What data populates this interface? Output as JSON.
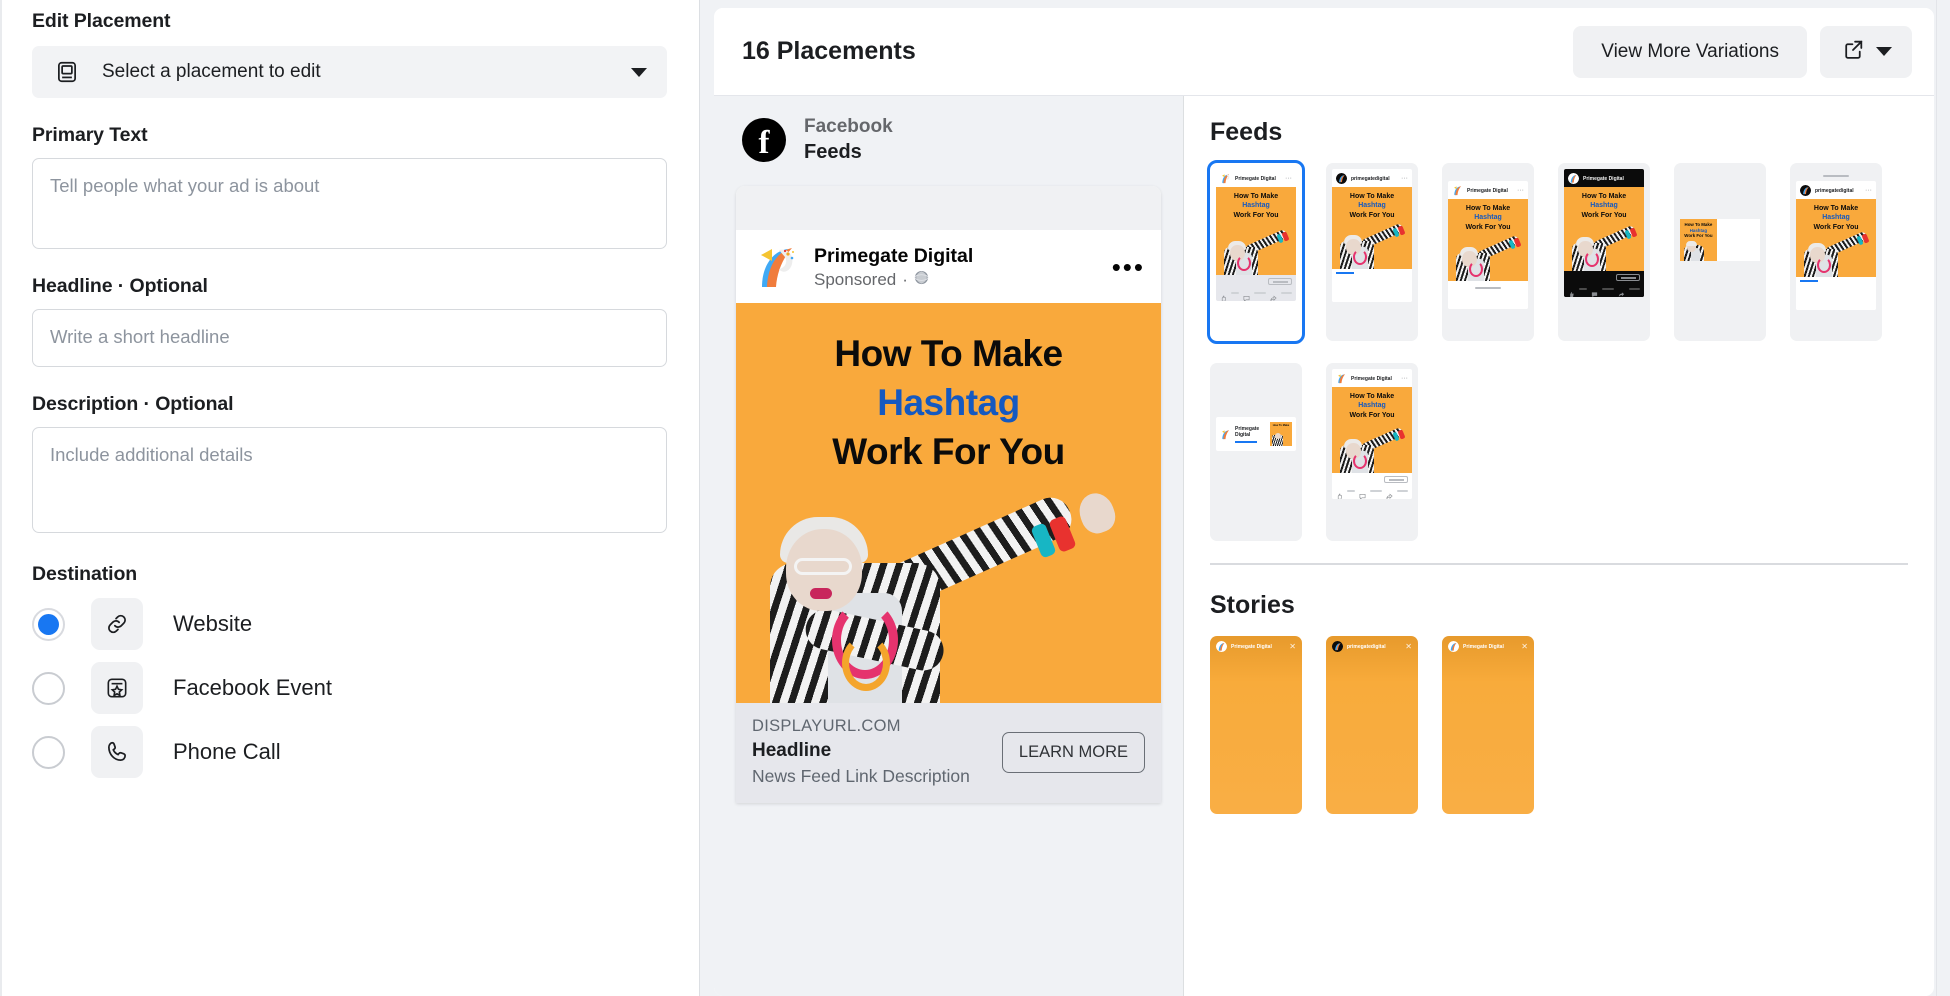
{
  "left_panel": {
    "edit_placement_label": "Edit Placement",
    "placement_select": {
      "text": "Select a placement to edit",
      "icon": "monitor-icon",
      "caret": "chevron-down-icon"
    },
    "primary_text": {
      "label": "Primary Text",
      "placeholder": "Tell people what your ad is about",
      "value": ""
    },
    "headline": {
      "label": "Headline",
      "optional_suffix": " · Optional",
      "placeholder": "Write a short headline",
      "value": ""
    },
    "description": {
      "label": "Description",
      "optional_suffix": " · Optional",
      "placeholder": "Include additional details",
      "value": ""
    },
    "destination": {
      "label": "Destination",
      "selected": "Website",
      "options": [
        {
          "label": "Website",
          "icon": "link-icon",
          "checked": true
        },
        {
          "label": "Facebook Event",
          "icon": "event-star-icon",
          "checked": false
        },
        {
          "label": "Phone Call",
          "icon": "phone-icon",
          "checked": false
        }
      ]
    }
  },
  "preview": {
    "header": {
      "title": "16 Placements",
      "view_more_label": "View More Variations",
      "open_icon": "external-link-icon",
      "caret_icon": "chevron-down-icon"
    },
    "platform": {
      "logo_icon": "facebook-icon",
      "name": "Facebook",
      "surface": "Feeds"
    },
    "ad": {
      "page_name": "Primegate Digital",
      "sponsored_label": "Sponsored",
      "sponsored_separator": "·",
      "globe_icon": "globe-icon",
      "menu_icon": "more-options-icon",
      "creative": {
        "line1": "How To Make",
        "line2": "Hashtag",
        "line3": "Work For You",
        "bg_color": "#F9A93C",
        "accent_color": "#1559C0"
      },
      "footer": {
        "display_url": "DISPLAYURL.COM",
        "headline": "Headline",
        "description": "News Feed Link Description",
        "cta": "LEARN MORE"
      }
    }
  },
  "thumbnails": {
    "feeds": {
      "title": "Feeds",
      "items": [
        {
          "page_name": "Primegate Digital",
          "style": "facebook-feed",
          "selected": true
        },
        {
          "page_name": "primegatedigital",
          "style": "instagram-feed",
          "selected": false
        },
        {
          "page_name": "Primegate Digital",
          "style": "plain-feed",
          "selected": false
        },
        {
          "page_name": "Primegate Digital",
          "style": "dark-feed",
          "selected": false
        },
        {
          "page_name": "",
          "style": "in-article",
          "selected": false
        },
        {
          "page_name": "primegatedigital",
          "style": "instagram-feed",
          "selected": false
        },
        {
          "page_name": "Primegate Digital",
          "style": "audience-network",
          "selected": false
        },
        {
          "page_name": "Primegate Digital",
          "style": "facebook-feed",
          "selected": false
        }
      ]
    },
    "stories": {
      "title": "Stories",
      "items": [
        {
          "page_name": "Primegate Digital",
          "close_icon": "close-icon"
        },
        {
          "page_name": "primegatedigital",
          "close_icon": "close-icon"
        },
        {
          "page_name": "Primegate Digital",
          "close_icon": "close-icon"
        }
      ]
    }
  },
  "colors": {
    "accent_blue": "#1877f2",
    "creative_orange": "#F9A93C",
    "creative_blue": "#1559C0",
    "panel_grey": "#f0f2f5"
  }
}
